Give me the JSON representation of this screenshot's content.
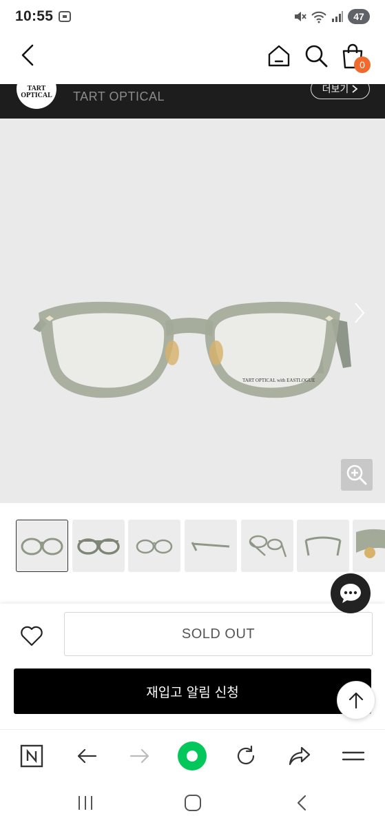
{
  "status_bar": {
    "time": "10:55",
    "battery": "47"
  },
  "header": {
    "cart_count": "0"
  },
  "brand": {
    "logo_text": "TART\nOPTICAL",
    "name": "TART OPTICAL",
    "more_label": "더보기"
  },
  "product_image": {
    "frame_print": "TART OPTICAL with EASTLOGUE"
  },
  "purchase": {
    "sold_out_label": "SOLD OUT",
    "restock_label": "재입고 알림 신청"
  },
  "colors": {
    "accent_cart_badge": "#ef6a2c",
    "brand_bar": "#1d1d1d",
    "restock_button": "#000000",
    "naver_green": "#03c75a"
  }
}
